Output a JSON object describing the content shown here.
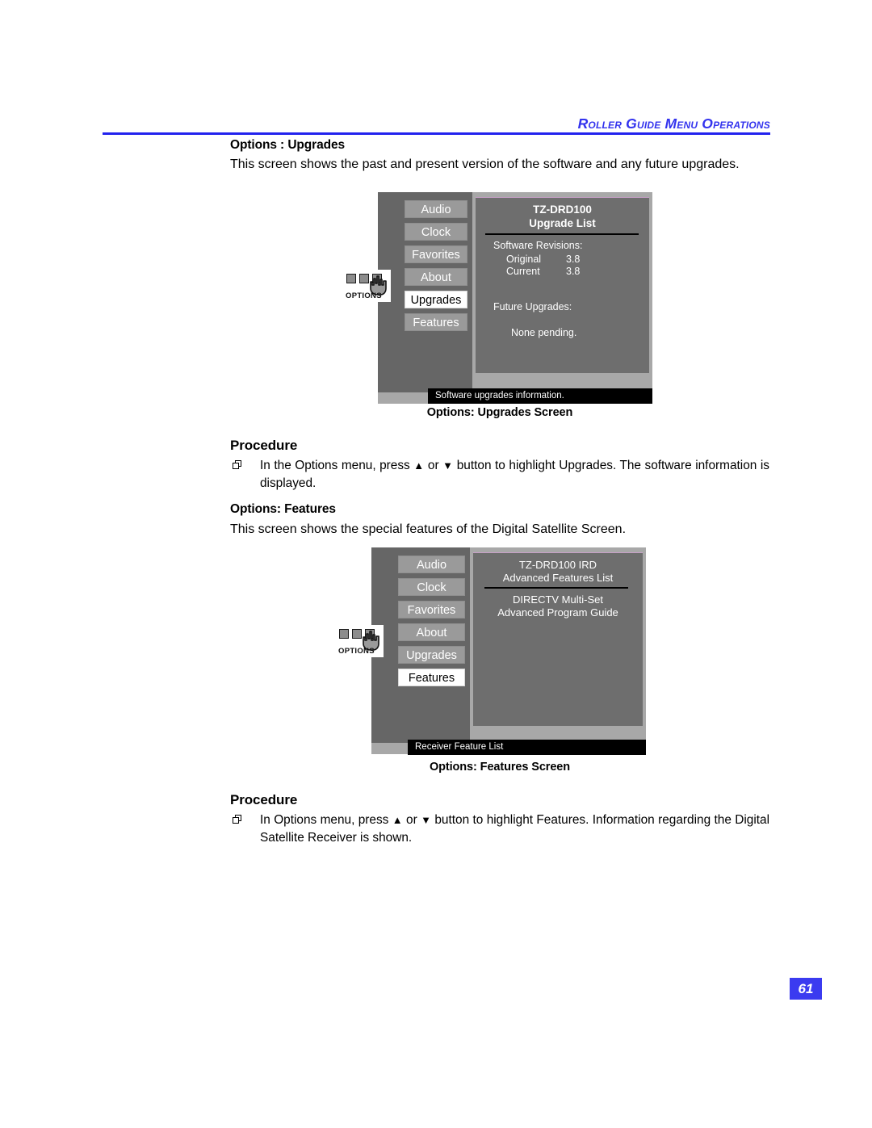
{
  "header": {
    "title": "Roller Guide Menu Operations"
  },
  "colors": {
    "header_blue": "#3333ee",
    "rule_blue": "#2222ee",
    "page_badge_blue": "#3b3bf0",
    "screen_outer_gray": "#a8a8a8",
    "screen_left_gray": "#666666",
    "screen_panel_gray": "#6e6e6e",
    "menu_item_gray": "#9a9a9a",
    "statusbar_black": "#000000"
  },
  "sections": [
    {
      "heading": "Options : Upgrades",
      "intro": "This screen shows the past and present version of the software and any future upgrades.",
      "caption": "Options: Upgrades Screen",
      "procedure_heading": "Procedure",
      "procedure_pre": "In the Options menu, press ",
      "procedure_mid": " or ",
      "procedure_post": " button to highlight Upgrades. The software information is displayed."
    },
    {
      "heading": "Options: Features",
      "intro": "This screen shows the special features of the Digital Satellite Screen.",
      "caption": "Options: Features Screen",
      "procedure_heading": "Procedure",
      "procedure_pre": "In Options menu, press ",
      "procedure_mid": " or ",
      "procedure_post": " button to highlight Features. Information regarding the Digital Satellite Receiver is shown."
    }
  ],
  "arrows": {
    "up": "▲",
    "down": "▼"
  },
  "screen_upgrades": {
    "options_icon_label": "OPTIONS",
    "menu_items": [
      {
        "label": "Audio",
        "selected": false
      },
      {
        "label": "Clock",
        "selected": false
      },
      {
        "label": "Favorites",
        "selected": false
      },
      {
        "label": "About",
        "selected": false
      },
      {
        "label": "Upgrades",
        "selected": true
      },
      {
        "label": "Features",
        "selected": false
      }
    ],
    "panel_title_line1": "TZ-DRD100",
    "panel_title_line2": "Upgrade List",
    "revisions_heading": "Software Revisions:",
    "revision_rows": [
      {
        "label": "Original",
        "value": "3.8"
      },
      {
        "label": "Current",
        "value": "3.8"
      }
    ],
    "future_heading": "Future Upgrades:",
    "future_value": "None pending.",
    "statusbar": "Software upgrades information."
  },
  "screen_features": {
    "options_icon_label": "OPTIONS",
    "menu_items": [
      {
        "label": "Audio",
        "selected": false
      },
      {
        "label": "Clock",
        "selected": false
      },
      {
        "label": "Favorites",
        "selected": false
      },
      {
        "label": "About",
        "selected": false
      },
      {
        "label": "Upgrades",
        "selected": false
      },
      {
        "label": "Features",
        "selected": true
      }
    ],
    "panel_title_line1": "TZ-DRD100 IRD",
    "panel_title_line2": "Advanced Features List",
    "feature_line1": "DIRECTV Multi-Set",
    "feature_line2": "Advanced Program Guide",
    "statusbar": "Receiver Feature List"
  },
  "page": {
    "number": "61"
  }
}
